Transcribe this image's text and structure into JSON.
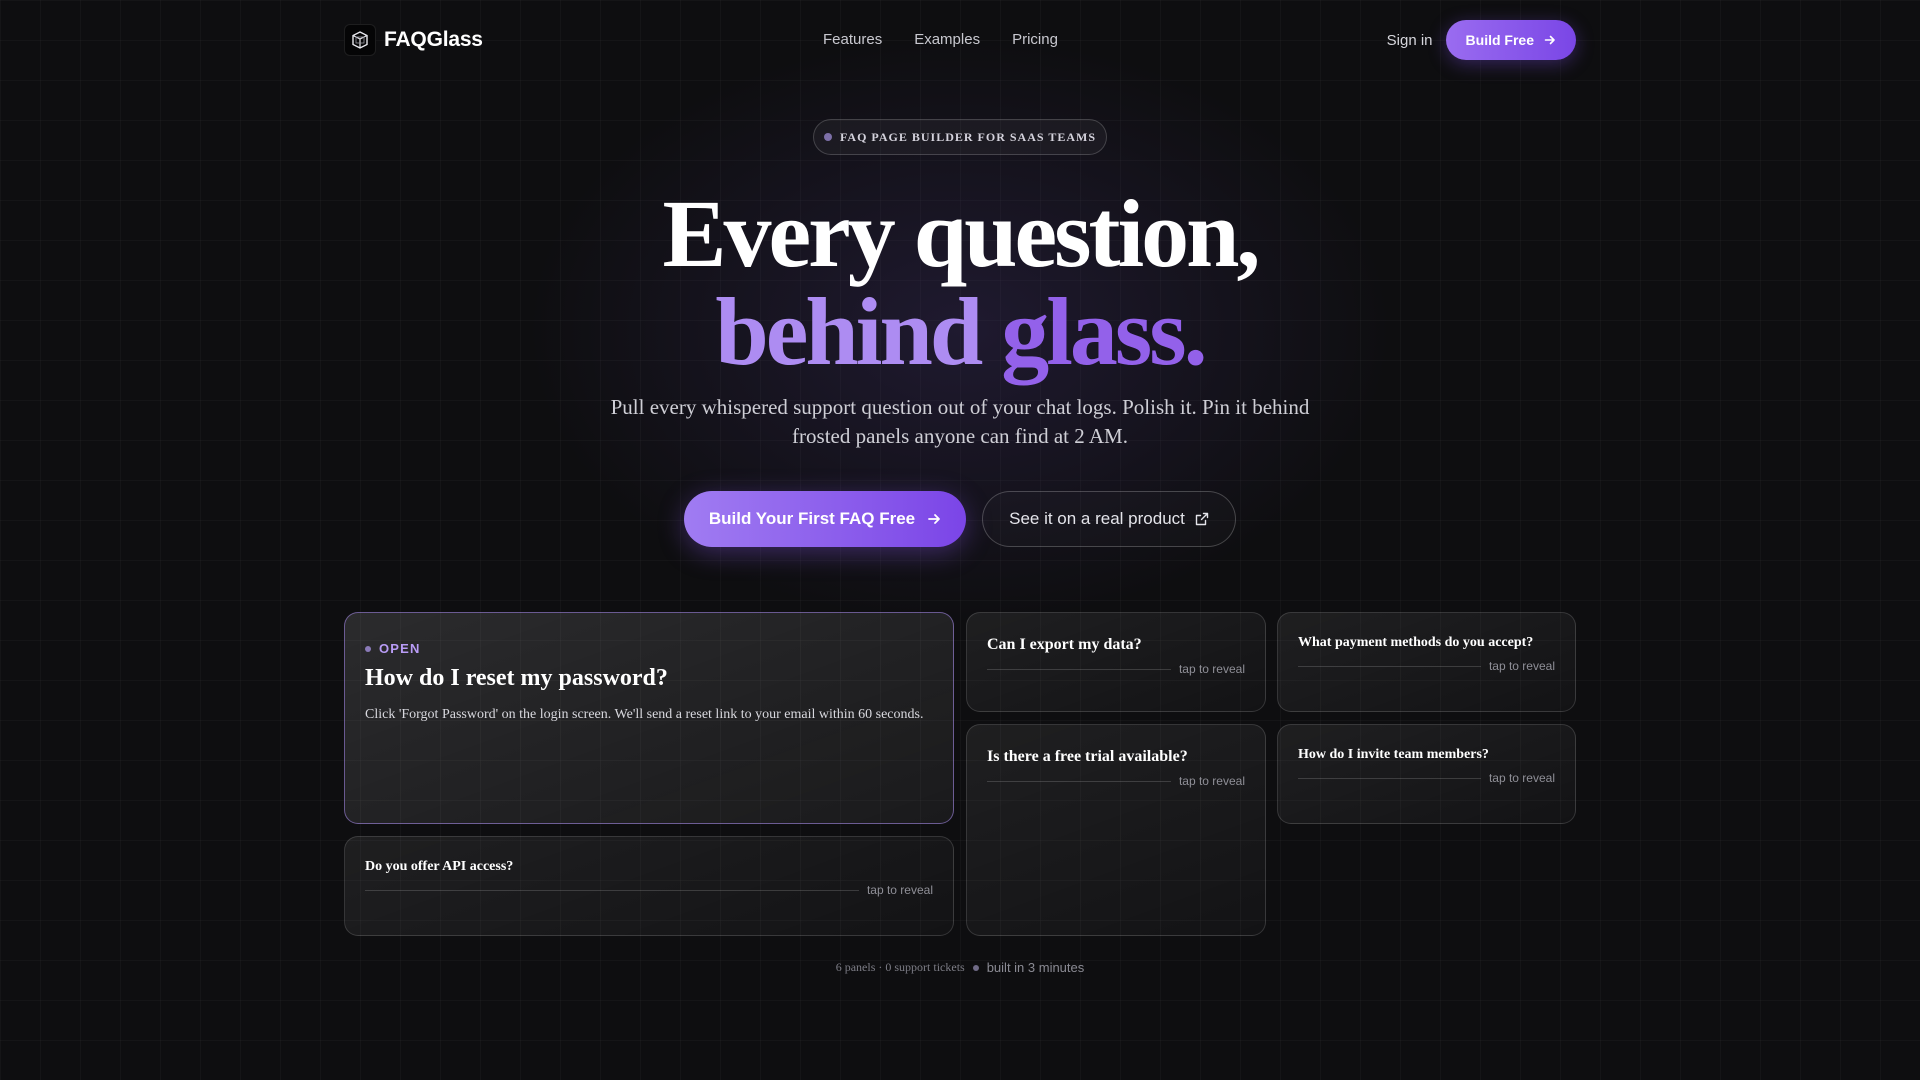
{
  "nav": {
    "brand": "FAQGlass",
    "brand_icon": "cube-icon",
    "links": [
      "Features",
      "Examples",
      "Pricing"
    ],
    "signin_label": "Sign in",
    "build_label": "Build Free"
  },
  "hero": {
    "badge": "FAQ PAGE BUILDER FOR SAAS TEAMS",
    "headline_line1": "Every question,",
    "headline_word1": "behind",
    "headline_word2": "glass.",
    "subtitle": "Pull every whispered support question out of your chat logs. Polish it. Pin it behind frosted panels anyone can find at 2 AM.",
    "cta_primary": "Build Your First FAQ Free",
    "cta_secondary": "See it on a real product"
  },
  "faq": {
    "open_label": "OPEN",
    "reveal_label": "tap to reveal",
    "items": [
      {
        "question": "How do I reset my password?",
        "answer": "Click 'Forgot Password' on the login screen. We'll send a reset link to your email within 60 seconds."
      },
      {
        "question": "Do you offer API access?"
      },
      {
        "question": "Can I export my data?"
      },
      {
        "question": "Is there a free trial available?"
      },
      {
        "question": "What payment methods do you accept?"
      },
      {
        "question": "How do I invite team members?"
      }
    ]
  },
  "footer": {
    "stats": "6 panels · 0 support tickets",
    "built": "built in 3 minutes"
  },
  "colors": {
    "background": "#0e0e10",
    "accent": "#8b5cf6",
    "accent_light": "#ad8cf2"
  }
}
